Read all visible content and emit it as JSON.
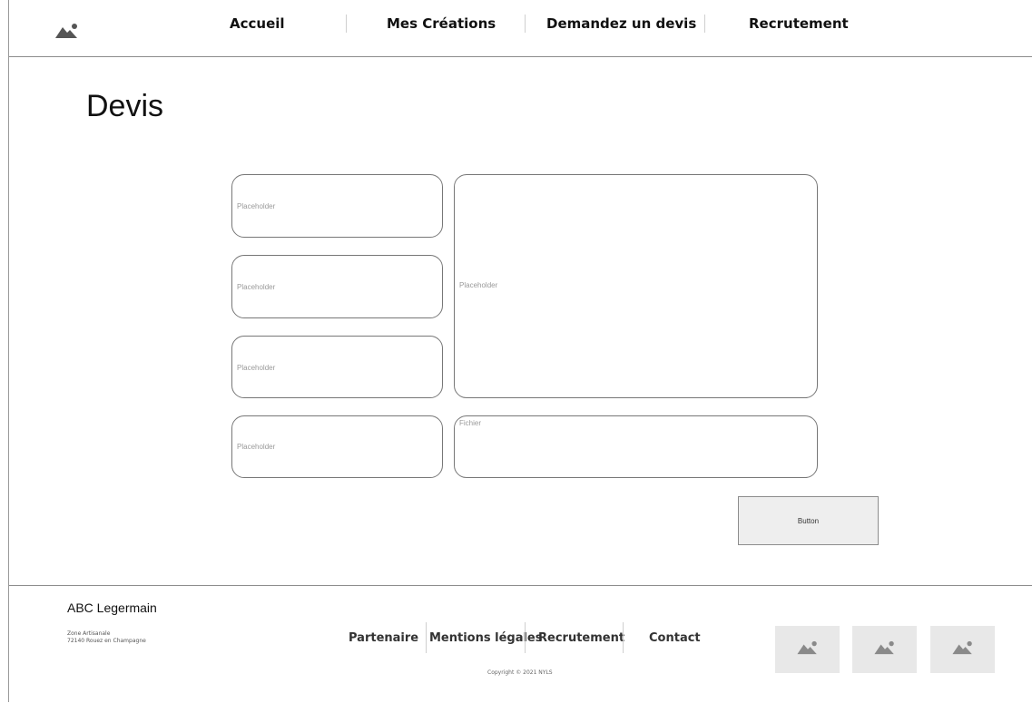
{
  "header": {
    "logo_icon": "image-placeholder-icon",
    "nav": [
      {
        "label": "Accueil"
      },
      {
        "label": "Mes Créations"
      },
      {
        "label": "Demandez un devis"
      },
      {
        "label": "Recrutement"
      }
    ]
  },
  "main": {
    "title": "Devis",
    "form": {
      "fields": [
        {
          "placeholder": "Placeholder"
        },
        {
          "placeholder": "Placeholder"
        },
        {
          "placeholder": "Placeholder"
        },
        {
          "placeholder": "Placeholder"
        }
      ],
      "message_placeholder": "Placeholder",
      "file_placeholder": "Fichier",
      "submit_label": "Button"
    }
  },
  "footer": {
    "brand": "ABC Legermain",
    "address_line1": "Zone Artisanale",
    "address_line2": "72140 Rouez en Champagne",
    "links": [
      {
        "label": "Partenaire"
      },
      {
        "label": "Mentions légales"
      },
      {
        "label": "Recrutement"
      },
      {
        "label": "Contact"
      }
    ],
    "copyright": "Copyright © 2021 NYLS",
    "thumbnail_icon": "image-placeholder-icon"
  },
  "colors": {
    "border": "#777777",
    "placeholder_text": "#9a9a9a",
    "button_bg": "#eeeeee",
    "thumbnail_bg": "#e8e8e8",
    "icon": "#555555"
  }
}
